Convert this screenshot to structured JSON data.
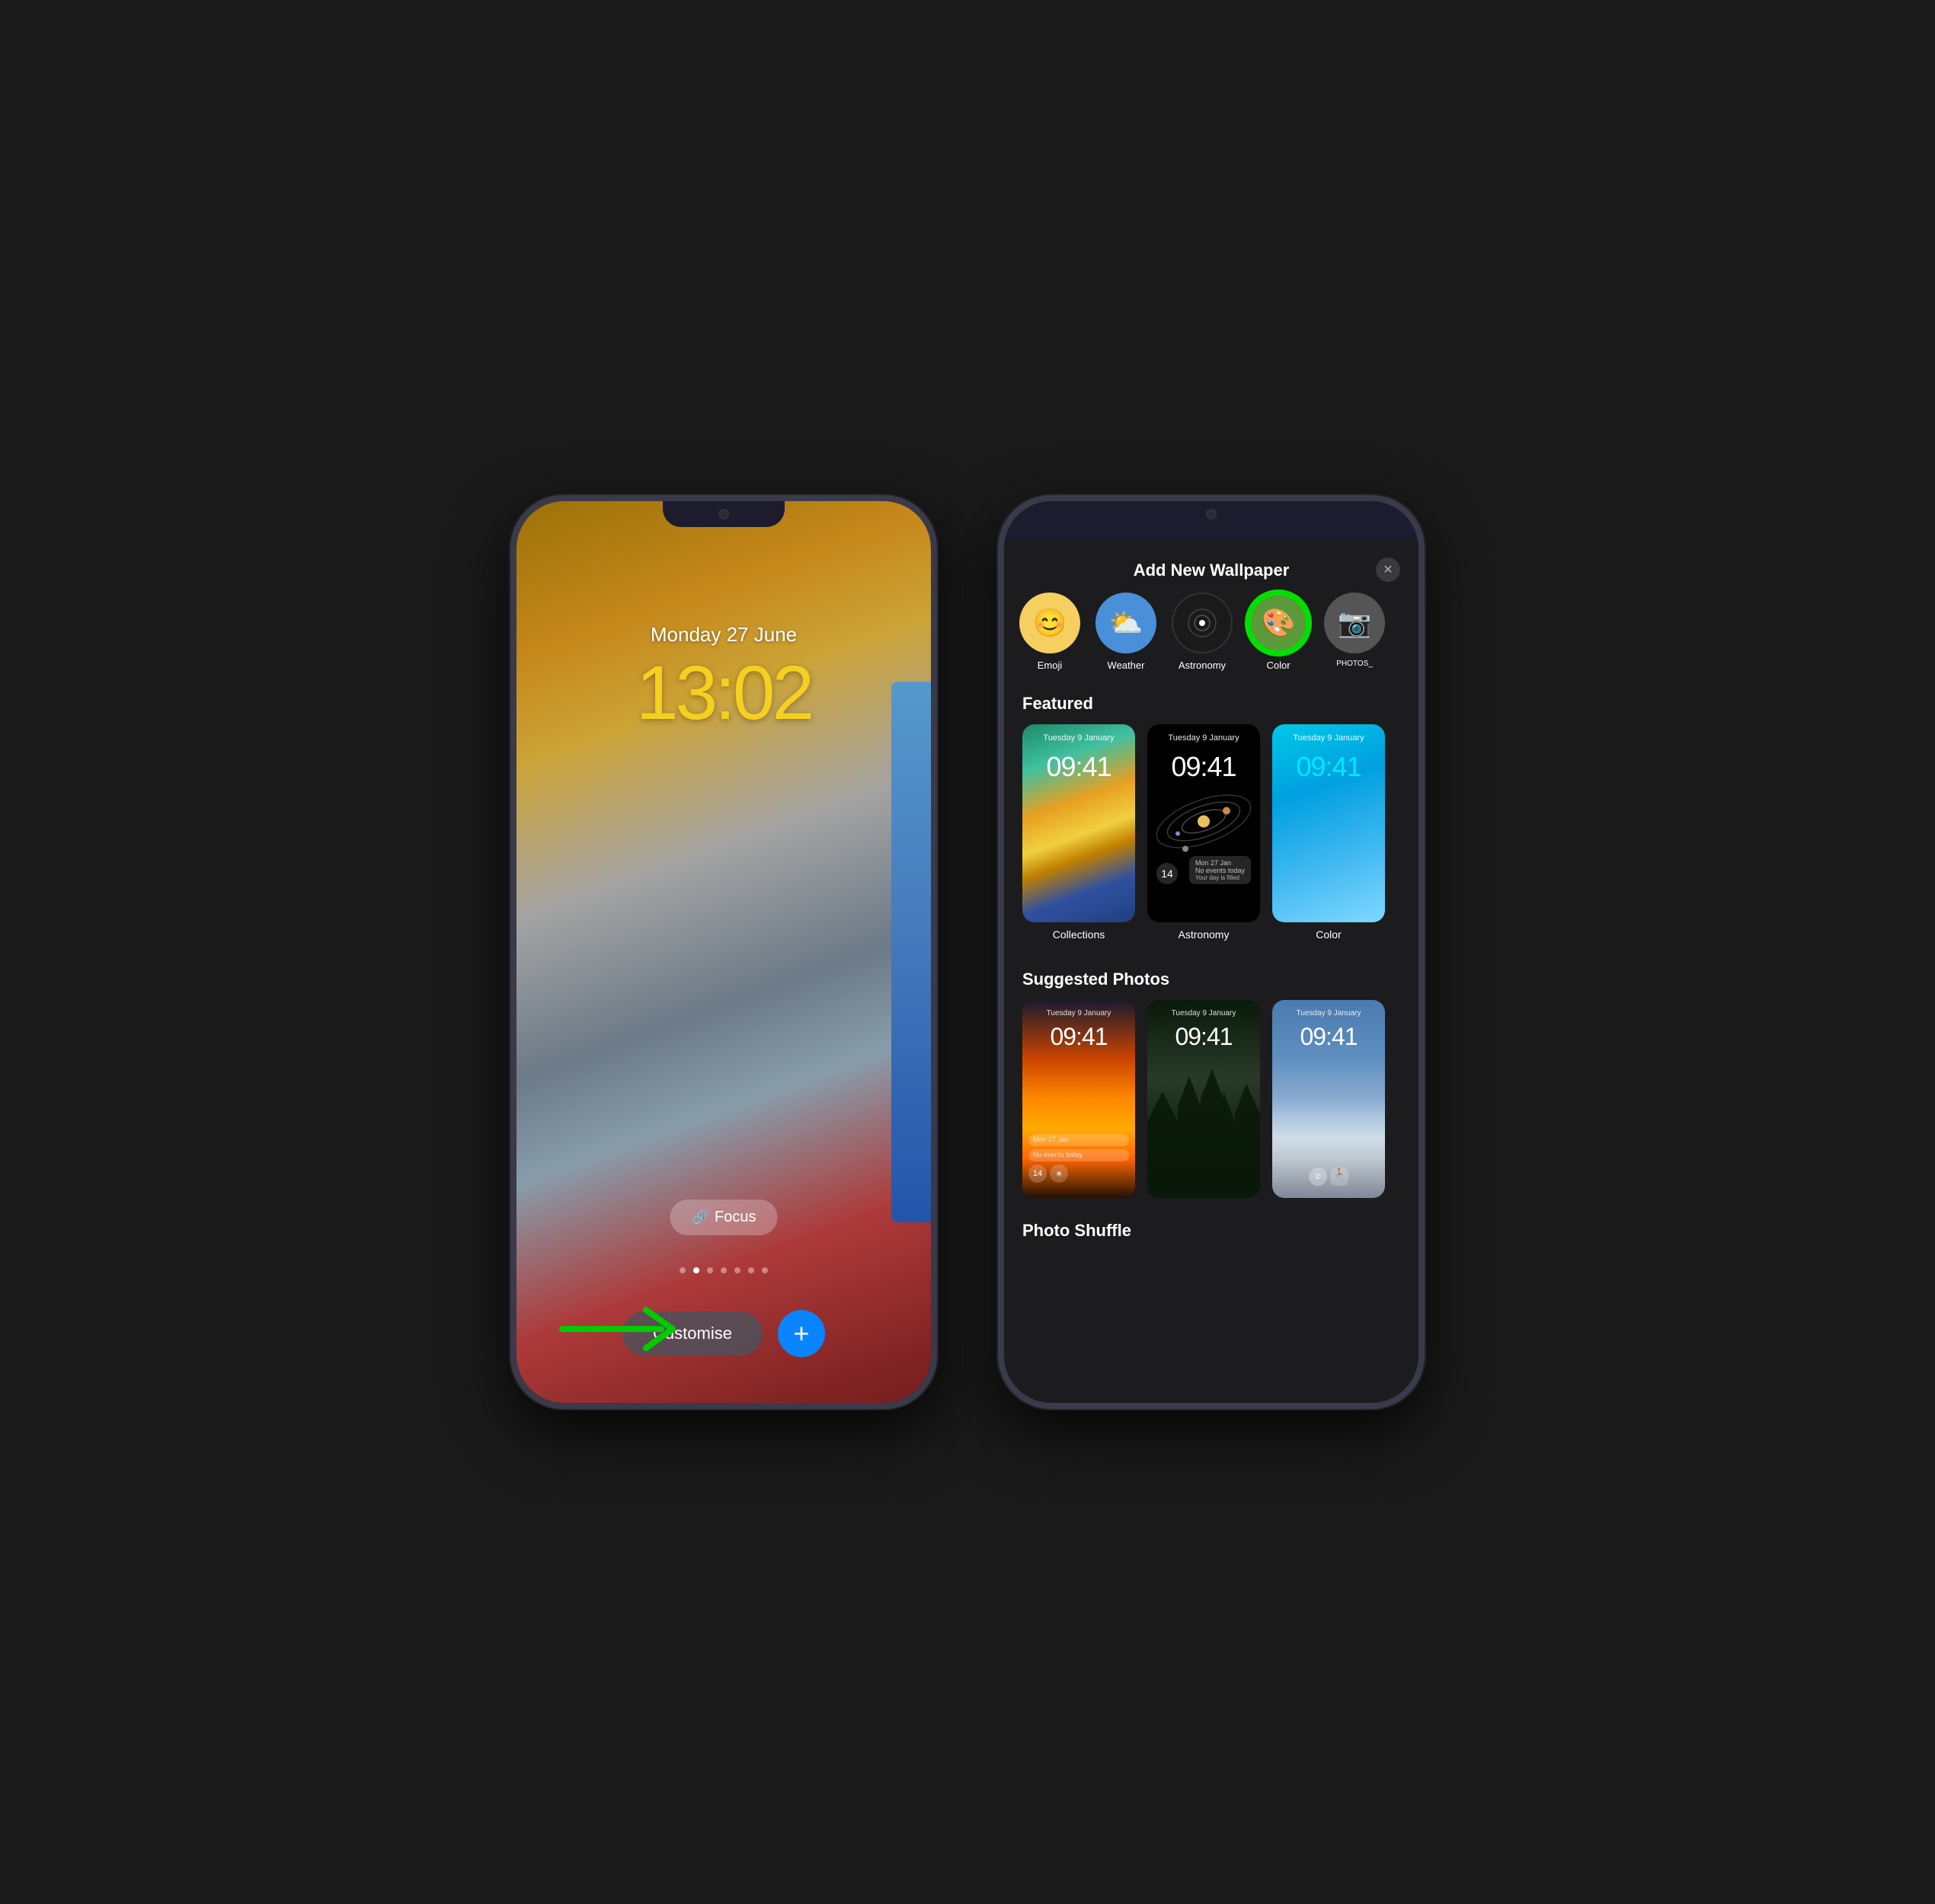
{
  "leftPhone": {
    "date": "Monday 27 June",
    "time": "13:02",
    "focusLabel": "Focus",
    "customiseLabel": "Customise",
    "plusIcon": "+",
    "dots": [
      false,
      true,
      false,
      false,
      false,
      false,
      false
    ]
  },
  "rightPhone": {
    "modalTitle": "Add New Wallpaper",
    "closeIcon": "✕",
    "categories": [
      {
        "id": "emoji",
        "label": "Emoji",
        "icon": "😊",
        "bg": "cat-emoji",
        "selected": false
      },
      {
        "id": "weather",
        "label": "Weather",
        "icon": "⛅",
        "bg": "cat-weather",
        "selected": false
      },
      {
        "id": "astronomy",
        "label": "Astronomy",
        "icon": "🔭",
        "bg": "cat-astronomy",
        "selected": false
      },
      {
        "id": "color",
        "label": "Color",
        "icon": "🎨",
        "bg": "cat-color",
        "selected": true
      },
      {
        "id": "photos",
        "label": "PHOTOS_PER_DESC",
        "icon": "📷",
        "bg": "cat-photos",
        "selected": false
      }
    ],
    "featuredTitle": "Featured",
    "featuredCards": [
      {
        "id": "collections",
        "label": "Collections",
        "date": "Tuesday 9 January",
        "time": "09:41"
      },
      {
        "id": "astronomy",
        "label": "Astronomy",
        "date": "Tuesday 9 January",
        "time": "09:41"
      },
      {
        "id": "color",
        "label": "Color",
        "date": "Tuesday 9 January",
        "time": "09:41"
      }
    ],
    "suggestedTitle": "Suggested Photos",
    "suggestedCards": [
      {
        "id": "sunset",
        "label": "",
        "date": "Tuesday 9 January",
        "time": "09:41"
      },
      {
        "id": "forest",
        "label": "",
        "date": "Tuesday 9 January",
        "time": "09:41"
      },
      {
        "id": "mountain",
        "label": "",
        "date": "Tuesday 9 January",
        "time": "09:41"
      }
    ],
    "photoShuffleTitle": "Photo Shuffle"
  }
}
